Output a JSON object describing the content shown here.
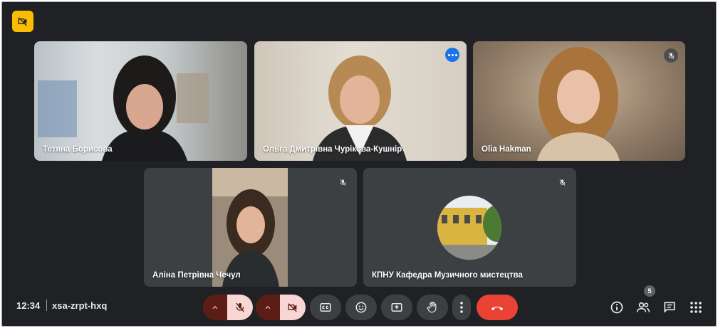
{
  "participants": [
    {
      "name": "Тетяна Борисова"
    },
    {
      "name": "Ольга Дмитрівна Чурікова-Кушнір"
    },
    {
      "name": "Olia Hakman"
    },
    {
      "name": "Аліна Петрівна Чечул"
    },
    {
      "name": "КПНУ Кафедра Музичного мистецтва"
    }
  ],
  "meeting": {
    "time": "12:34",
    "code": "xsa-zrpt-hxq"
  },
  "people_count": "5",
  "colors": {
    "background": "#202124",
    "tile": "#3c4043",
    "end_call": "#ea4335",
    "badge": "#fbbc04",
    "active_border": "#8ab4f8"
  },
  "icons": [
    "camera-off-icon",
    "mic-off-icon",
    "more-options-icon",
    "caret-up-icon",
    "captions-icon",
    "emoji-icon",
    "present-icon",
    "raise-hand-icon",
    "more-vert-icon",
    "end-call-icon",
    "info-icon",
    "people-icon",
    "chat-icon",
    "apps-icon"
  ]
}
